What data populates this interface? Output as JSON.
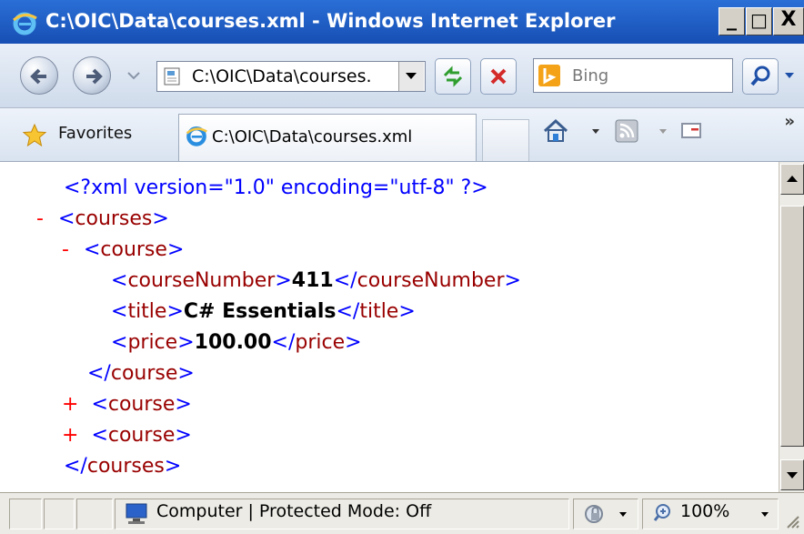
{
  "window": {
    "title": "C:\\OIC\\Data\\courses.xml - Windows Internet Explorer",
    "controls": {
      "minimize": "_",
      "maximize": "□",
      "close": "X"
    }
  },
  "nav": {
    "address": "C:\\OIC\\Data\\courses.",
    "search_placeholder": "Bing"
  },
  "favorites": {
    "label": "Favorites",
    "tab_label": "C:\\OIC\\Data\\courses.xml",
    "overflow": "»"
  },
  "xml": {
    "declaration": "<?xml version=\"1.0\" encoding=\"utf-8\" ?>",
    "lines": [
      {
        "sign": "-",
        "open": "<",
        "name": "courses",
        "close": ">"
      },
      {
        "sign": "-",
        "open": "<",
        "name": "course",
        "close": ">"
      },
      {
        "open": "<",
        "name": "courseNumber",
        "mid": ">",
        "value": "411",
        "endopen": "</",
        "endname": "courseNumber",
        "endclose": ">"
      },
      {
        "open": "<",
        "name": "title",
        "mid": ">",
        "value": "C# Essentials",
        "endopen": "</",
        "endname": "title",
        "endclose": ">"
      },
      {
        "open": "<",
        "name": "price",
        "mid": ">",
        "value": "100.00",
        "endopen": "</",
        "endname": "price",
        "endclose": ">"
      },
      {
        "open": "</",
        "name": "course",
        "close": ">"
      },
      {
        "sign": "+",
        "open": "<",
        "name": "course",
        "close": ">"
      },
      {
        "sign": "+",
        "open": "<",
        "name": "course",
        "close": ">"
      },
      {
        "open": "</",
        "name": "courses",
        "close": ">"
      }
    ]
  },
  "status": {
    "zone": "Computer | Protected Mode: Off",
    "zoom": "100%"
  },
  "colors": {
    "title_bar": "#174fb4",
    "tag_blue": "#0000ff",
    "tag_name": "#990000",
    "toggle_red": "#ff0000"
  }
}
